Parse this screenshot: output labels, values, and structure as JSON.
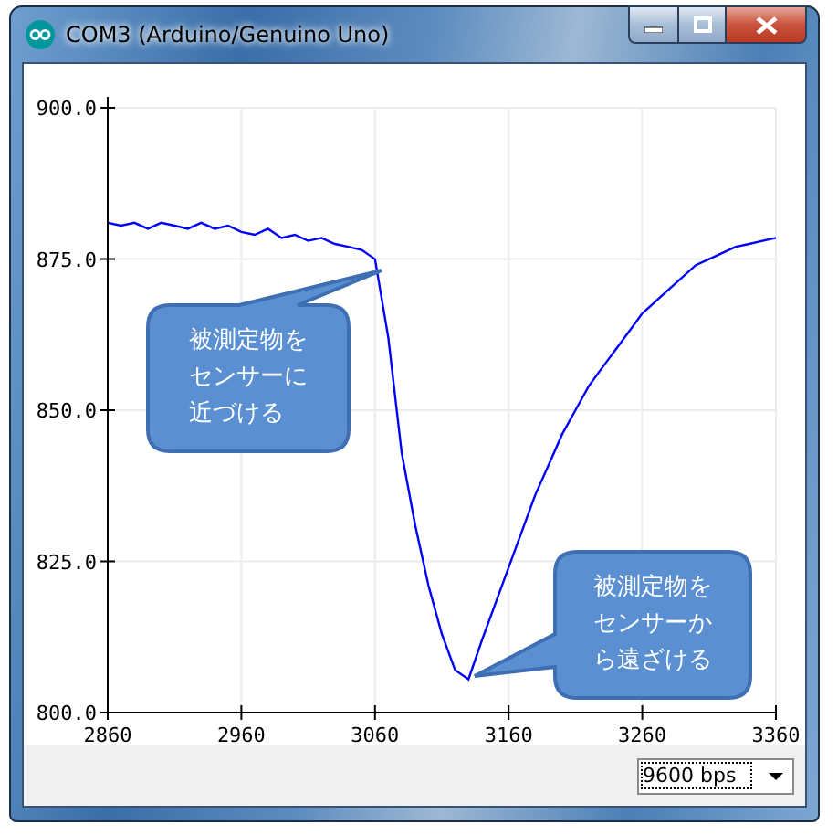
{
  "window": {
    "title": "COM3 (Arduino/Genuino Uno)"
  },
  "plot": {
    "chart_data": {
      "type": "line",
      "x": [
        2860,
        2870,
        2880,
        2890,
        2900,
        2910,
        2920,
        2930,
        2940,
        2950,
        2960,
        2970,
        2980,
        2990,
        3000,
        3010,
        3020,
        3030,
        3040,
        3050,
        3060,
        3070,
        3080,
        3090,
        3100,
        3110,
        3120,
        3130,
        3140,
        3150,
        3160,
        3170,
        3180,
        3190,
        3200,
        3210,
        3220,
        3230,
        3240,
        3250,
        3260,
        3270,
        3280,
        3290,
        3300,
        3310,
        3320,
        3330,
        3340,
        3350,
        3360
      ],
      "series": [
        {
          "color": "#0000ff",
          "values": [
            881,
            880.5,
            881,
            880,
            881,
            880.5,
            880,
            881,
            880,
            880.5,
            879.5,
            879,
            880,
            878.5,
            879,
            878,
            878.5,
            877.5,
            877,
            876.5,
            875,
            862,
            843,
            831,
            821,
            813,
            807,
            805.5,
            812,
            818,
            824,
            830,
            836,
            841,
            846,
            850,
            854,
            857,
            860,
            863,
            866,
            868,
            870,
            872,
            874,
            875,
            876,
            877,
            877.5,
            878,
            878.5
          ]
        }
      ],
      "xlim": [
        2860,
        3360
      ],
      "ylim": [
        800,
        900
      ],
      "xticks": [
        2860,
        2960,
        3060,
        3160,
        3260,
        3360
      ],
      "yticks": [
        {
          "value": 800,
          "label": "800.0"
        },
        {
          "value": 825,
          "label": "825.0"
        },
        {
          "value": 850,
          "label": "850.0"
        },
        {
          "value": 875,
          "label": "875.0"
        },
        {
          "value": 900,
          "label": "900.0"
        }
      ],
      "grid": true,
      "annotations": [
        "被測定物をセンサーに近づける",
        "被測定物をセンサーから遠ざける"
      ]
    }
  },
  "baud_rate": {
    "value": "9600 bps"
  }
}
